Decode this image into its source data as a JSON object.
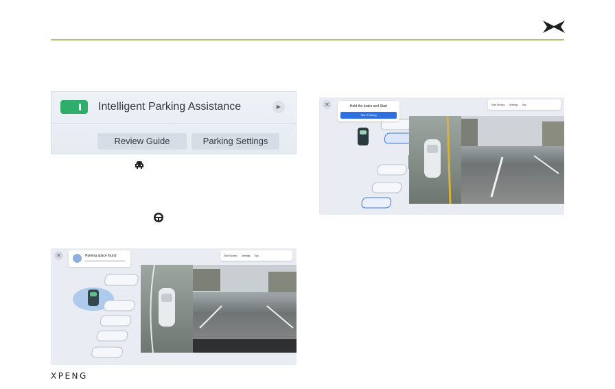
{
  "brand": "XPENG",
  "settings_panel": {
    "toggle_on": true,
    "title": "Intelligent Parking Assistance",
    "buttons": [
      "Review Guide",
      "Parking Settings"
    ]
  },
  "inline_icons": [
    "car-icon",
    "steering-wheel-icon"
  ],
  "screen_a": {
    "notice_title": "Parking space found",
    "topbar": [
      "Side Monitor",
      "Settings",
      "Tips"
    ]
  },
  "screen_b": {
    "notice_title": "Hold the brake and Start",
    "start_button": "Start Parking",
    "topbar": [
      "Side Monitor",
      "Settings",
      "Tips"
    ]
  },
  "colors": {
    "accent_line": "#a8c66c",
    "toggle": "#2fae6b",
    "start_button": "#2f6fe0"
  }
}
